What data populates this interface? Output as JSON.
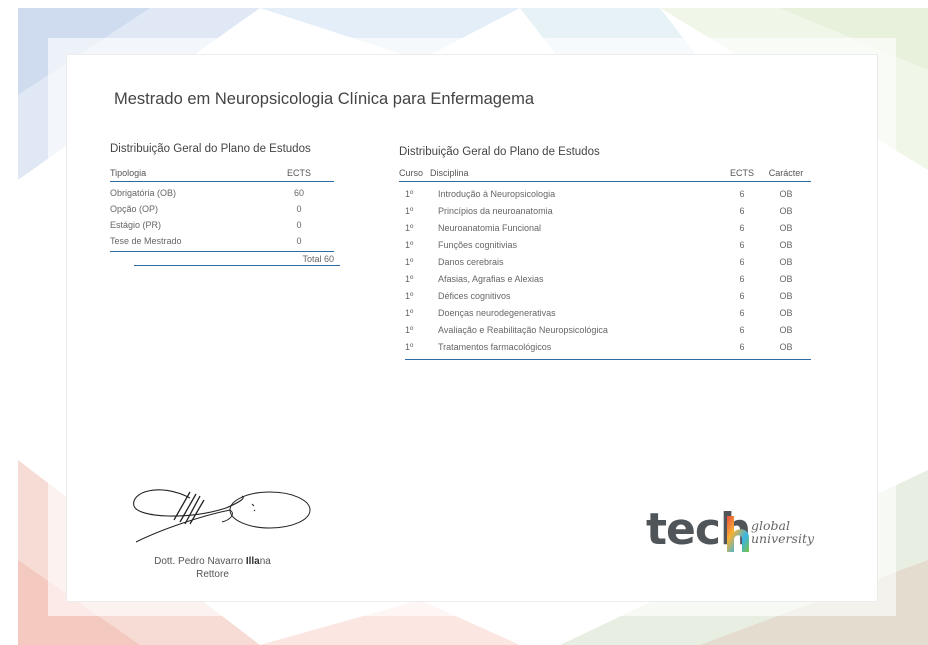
{
  "title": "Mestrado em Neuropsicologia Clínica para Enfermagema",
  "general_table": {
    "title": "Distribuição Geral do Plano de Estudos",
    "headers": [
      "Tipologia",
      "ECTS"
    ],
    "rows": [
      [
        "Obrigatória (OB)",
        "60"
      ],
      [
        "Opção (OP)",
        "0"
      ],
      [
        "Estágio (PR)",
        "0"
      ],
      [
        "Tese de Mestrado",
        "0"
      ]
    ],
    "total": "Total 60"
  },
  "detail_table": {
    "title": "Distribuição Geral do Plano de Estudos",
    "headers": [
      "Curso",
      "Disciplina",
      "ECTS",
      "Carácter"
    ],
    "rows": [
      [
        "1º",
        "Introdução à Neuropsicologia",
        "6",
        "OB"
      ],
      [
        "1º",
        "Princípios da neuroanatomia",
        "6",
        "OB"
      ],
      [
        "1º",
        "Neuroanatomia Funcional",
        "6",
        "OB"
      ],
      [
        "1º",
        "Funções cognitivias",
        "6",
        "OB"
      ],
      [
        "1º",
        "Danos cerebrais",
        "6",
        "OB"
      ],
      [
        "1º",
        "Afasias, Agrafias e Alexias",
        "6",
        "OB"
      ],
      [
        "1º",
        "Défices cognitivos",
        "6",
        "OB"
      ],
      [
        "1º",
        "Doenças neurodegenerativas",
        "6",
        "OB"
      ],
      [
        "1º",
        "Avaliação e Reabilitação Neuropsicológica",
        "6",
        "OB"
      ],
      [
        "1º",
        "Tratamentos farmacológicos",
        "6",
        "OB"
      ]
    ]
  },
  "signature": {
    "name_prefix": "Dott. Pedro Navarro ",
    "name_bold": "Illa",
    "name_suffix": "na",
    "role": "Rettore"
  },
  "logo": {
    "brand": "tech",
    "line1": "global",
    "line2": "university",
    "accent_colors": [
      "#e94e3c",
      "#f6b233",
      "#3ab5e6",
      "#7cc242"
    ]
  }
}
